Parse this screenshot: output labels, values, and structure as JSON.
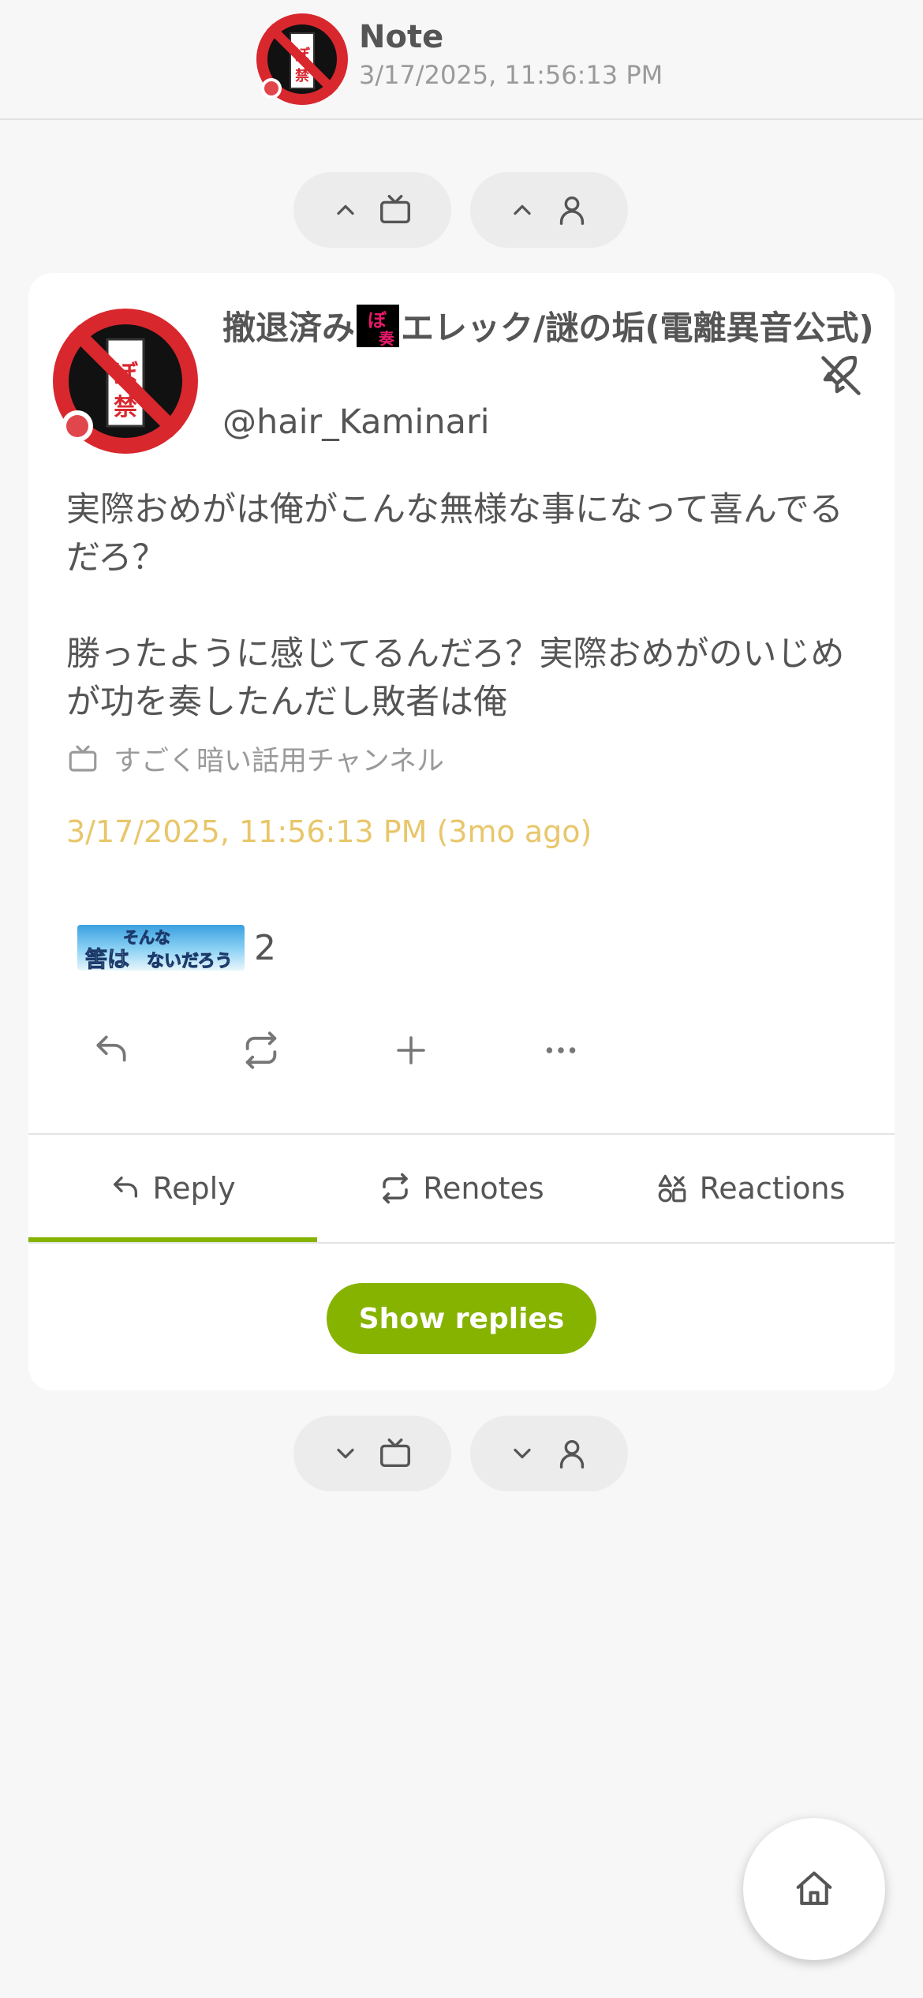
{
  "header": {
    "title": "Note",
    "subtitle": "3/17/2025, 11:56:13 PM"
  },
  "nav_top": {
    "prev_channel_icon": "chevron-up-tv-icon",
    "prev_user_icon": "chevron-up-user-icon"
  },
  "note": {
    "display_name": "撤退済み",
    "display_name_after_emoji": "エレック/謎の垢(電離異音公式)",
    "handle": "@hair_Kaminari",
    "body": "実際おめがは俺がこんな無様な事になって喜んでるだろ？\n\n勝ったように感じてるんだろ？実際おめがのいじめが功を奏したんだし敗者は俺",
    "channel": "すごく暗い話用チャンネル",
    "timestamp": "3/17/2025, 11:56:13 PM (3mo ago)",
    "reaction": {
      "emoji_text_top": "そんな",
      "emoji_text_left": "筈は",
      "emoji_text_right": "ないだろう",
      "count": "2"
    }
  },
  "tabs": [
    {
      "label": "Reply",
      "icon": "reply-icon",
      "active": true
    },
    {
      "label": "Renotes",
      "icon": "renote-icon",
      "active": false
    },
    {
      "label": "Reactions",
      "icon": "reactions-icon",
      "active": false
    }
  ],
  "show_replies_label": "Show replies",
  "colors": {
    "accent": "#86b300",
    "timestamp": "#e8c66a",
    "background": "#f7f7f7",
    "card": "#ffffff"
  }
}
